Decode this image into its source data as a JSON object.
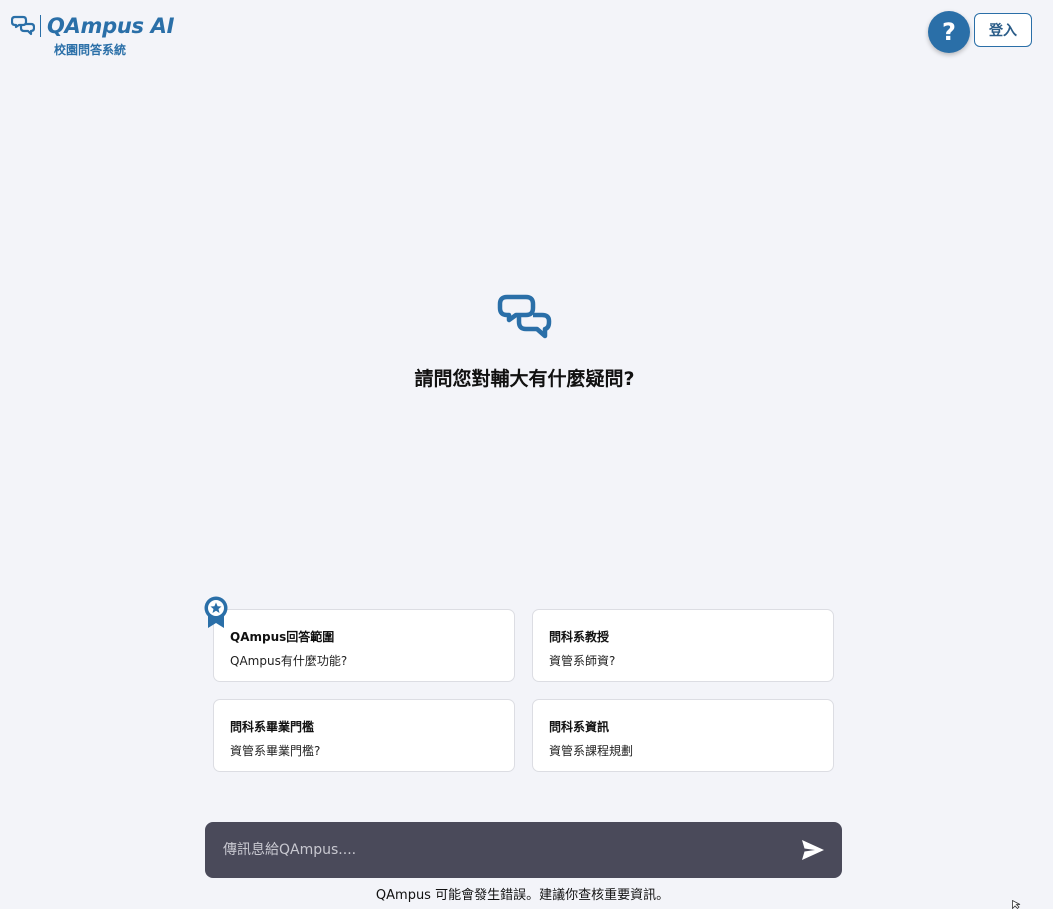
{
  "header": {
    "logo_text": "QAmpus AI",
    "logo_subtitle": "校園問答系統",
    "help_label": "?",
    "login_label": "登入"
  },
  "hero": {
    "title": "請問您對輔大有什麼疑問?"
  },
  "suggestions": [
    {
      "title": "QAmpus回答範圍",
      "subtitle": "QAmpus有什麼功能?"
    },
    {
      "title": "問科系教授",
      "subtitle": "資管系師資?"
    },
    {
      "title": "問科系畢業門檻",
      "subtitle": "資管系畢業門檻?"
    },
    {
      "title": "問科系資訊",
      "subtitle": "資管系課程規劃"
    }
  ],
  "composer": {
    "placeholder": "傳訊息給QAmpus....",
    "value": ""
  },
  "footer": {
    "disclaimer": "QAmpus 可能會發生錯誤。建議你查核重要資訊。"
  },
  "colors": {
    "brand": "#2a6fa8",
    "background": "#f3f4f9",
    "composer_bg": "#4a4a5a"
  },
  "icons": {
    "logo": "chat-bubbles-icon",
    "badge": "award-ribbon-icon",
    "send": "send-icon"
  }
}
